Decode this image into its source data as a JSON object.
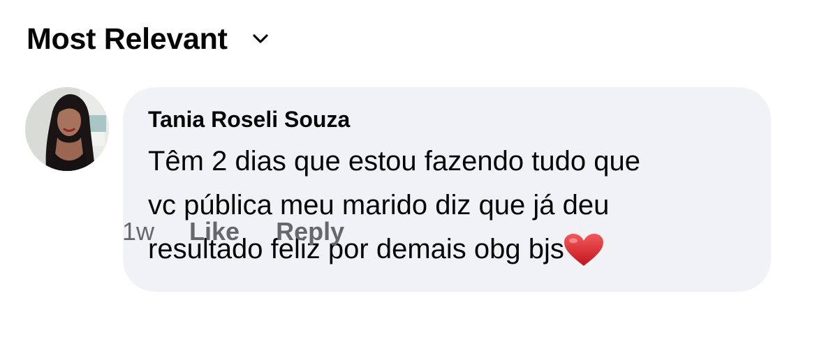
{
  "sort": {
    "label": "Most Relevant",
    "icon": "chevron-down-icon"
  },
  "comment": {
    "author": "Tania Roseli Souza",
    "lines": [
      "Têm 2 dias que estou fazendo tudo que",
      "vc pública meu marido diz que já deu",
      "resultado feliz por demais obg bjs"
    ],
    "emoji": "heart-icon",
    "time": "1w",
    "like_label": "Like",
    "reply_label": "Reply"
  },
  "colors": {
    "bubble_bg": "#f0f2f5",
    "text_primary": "#050505",
    "text_secondary": "#65676b",
    "heart": "#d6202b"
  }
}
